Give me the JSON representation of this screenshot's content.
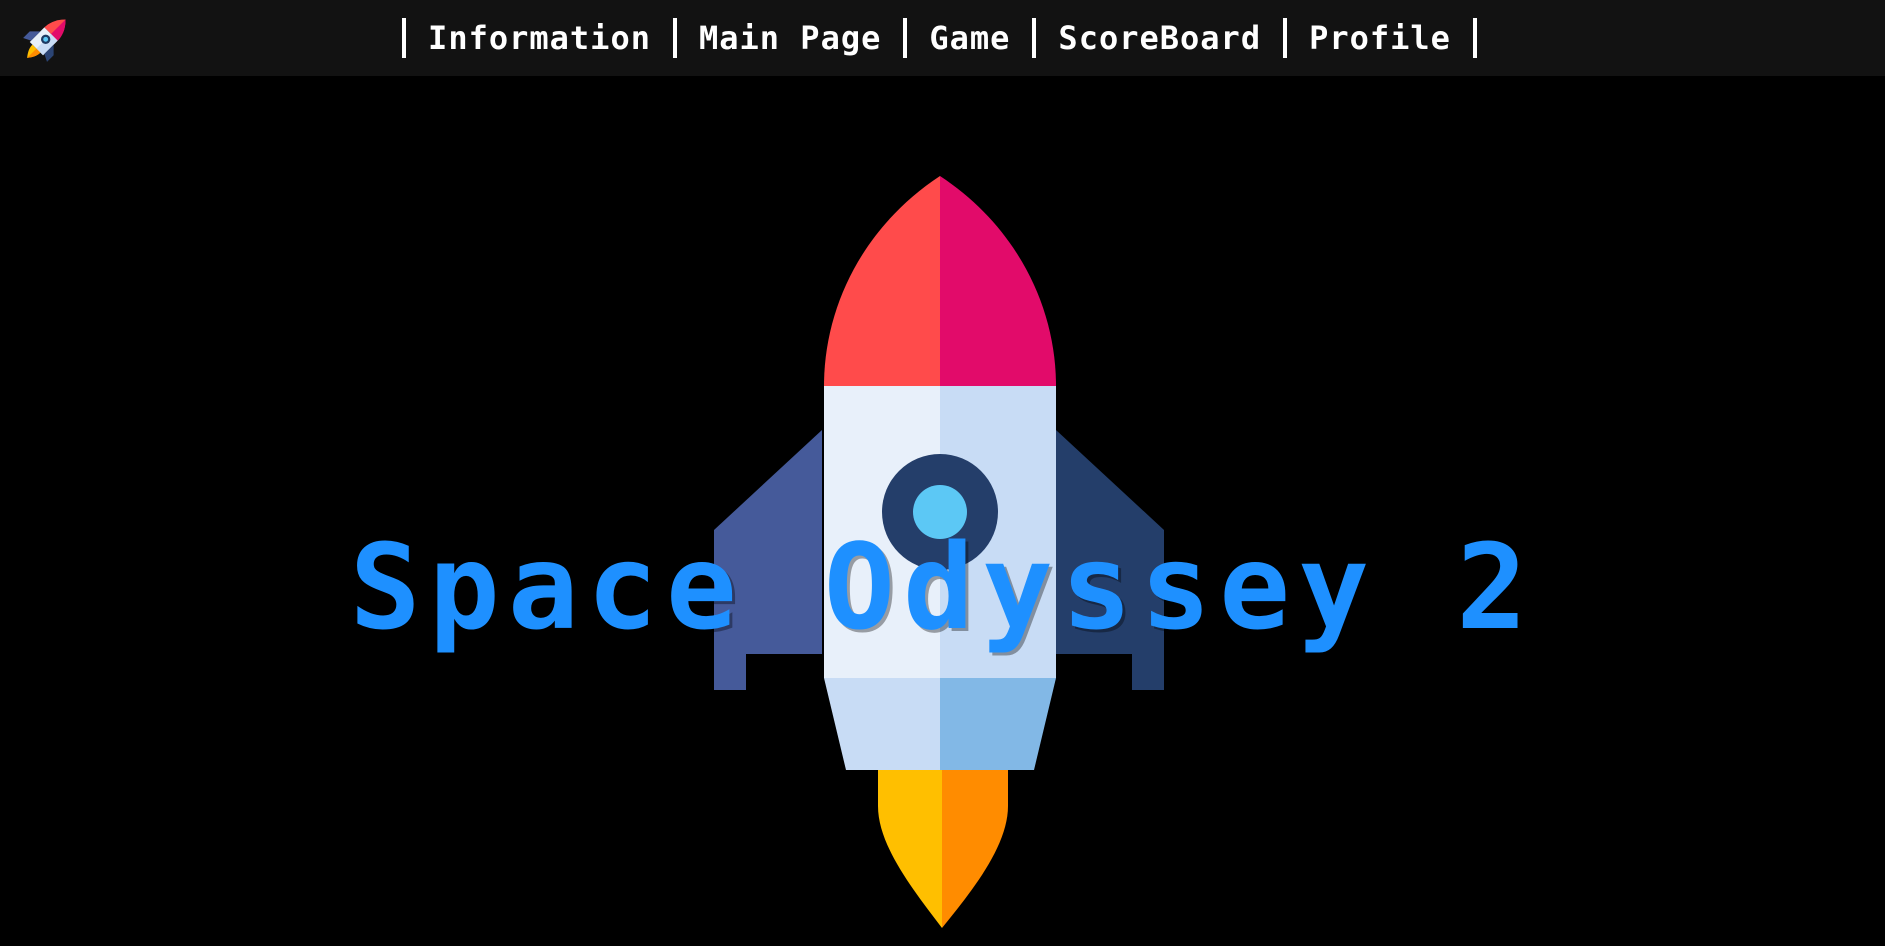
{
  "nav": {
    "logo_icon": "rocket-icon",
    "items": [
      {
        "label": "Information"
      },
      {
        "label": "Main Page"
      },
      {
        "label": "Game"
      },
      {
        "label": "ScoreBoard"
      },
      {
        "label": "Profile"
      }
    ]
  },
  "hero": {
    "title": "Space Odyssey 2",
    "image_icon": "rocket-illustration"
  },
  "colors": {
    "background": "#000000",
    "navbar": "#121212",
    "title": "#1e90ff",
    "nav_text": "#ffffff"
  }
}
